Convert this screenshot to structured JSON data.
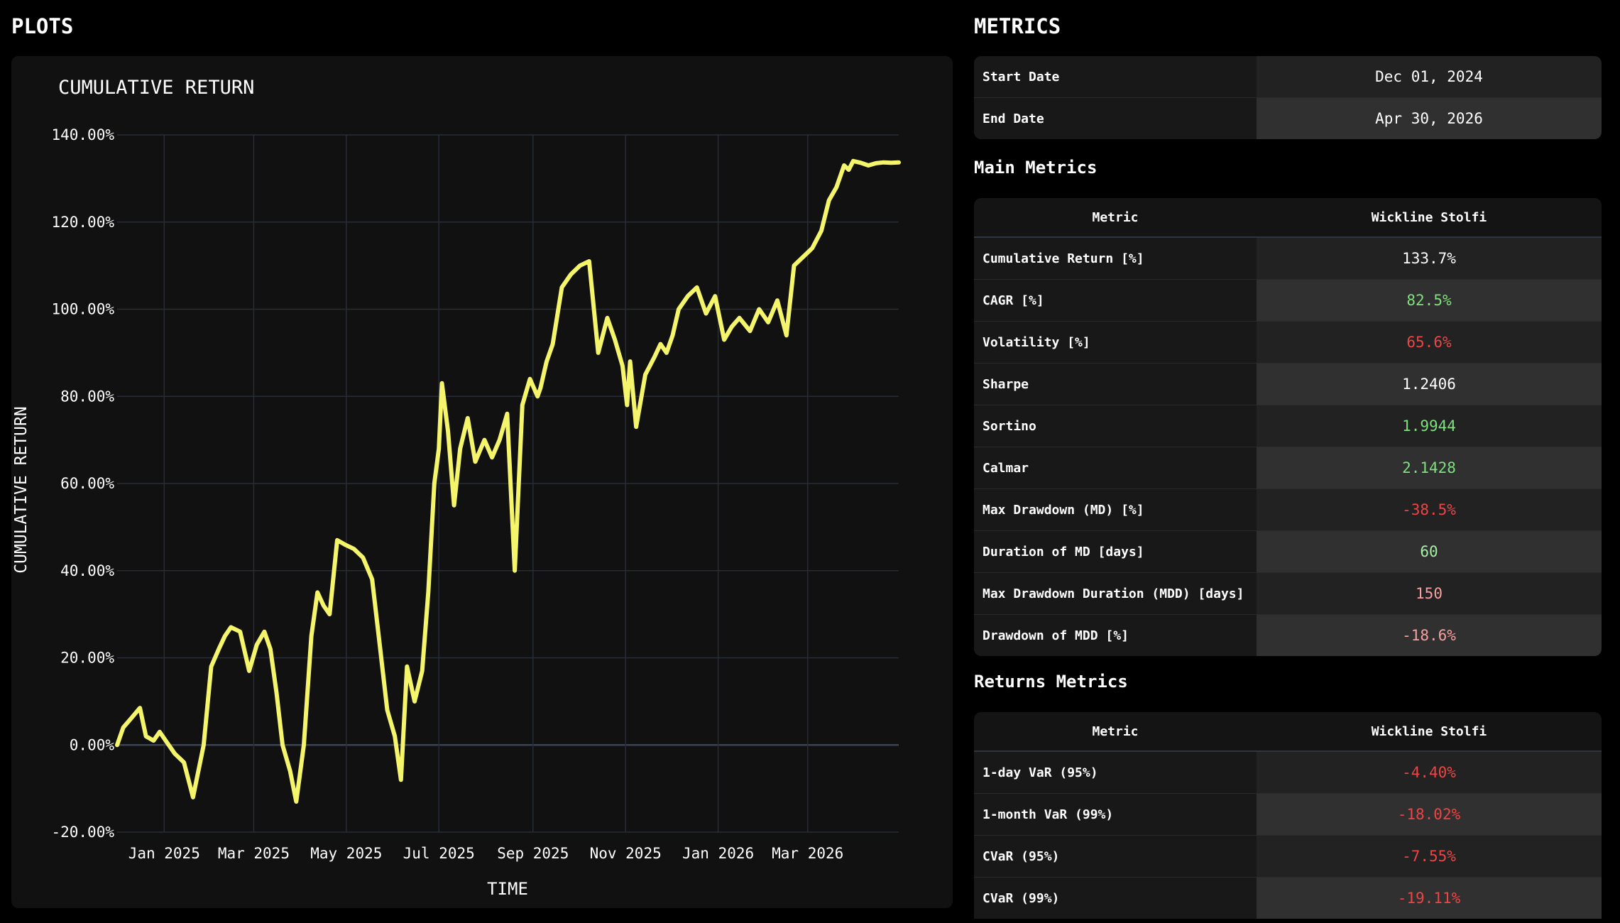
{
  "plots_heading": "PLOTS",
  "metrics_heading": "METRICS",
  "chart_data": {
    "type": "line",
    "title": "CUMULATIVE RETURN",
    "xlabel": "TIME",
    "ylabel": "CUMULATIVE RETURN",
    "ylim": [
      -0.2,
      1.4
    ],
    "yticks": [
      -0.2,
      0,
      0.2,
      0.4,
      0.6,
      0.8,
      1.0,
      1.2,
      1.4
    ],
    "ytick_labels": [
      "-20.00%",
      "0.00%",
      "20.00%",
      "40.00%",
      "60.00%",
      "80.00%",
      "100.00%",
      "120.00%",
      "140.00%"
    ],
    "xlim": [
      "2024-12-01",
      "2026-04-30"
    ],
    "xticks": [
      "2025-01-01",
      "2025-03-01",
      "2025-05-01",
      "2025-07-01",
      "2025-09-01",
      "2025-11-01",
      "2026-01-01",
      "2026-03-01"
    ],
    "xtick_labels": [
      "Jan 2025",
      "Mar 2025",
      "May 2025",
      "Jul 2025",
      "Sep 2025",
      "Nov 2025",
      "Jan 2026",
      "Mar 2026"
    ],
    "grid": true,
    "line_color": "#f5f56b",
    "series": [
      {
        "x": [
          "2024-12-01",
          "2024-12-05",
          "2024-12-10",
          "2024-12-16",
          "2024-12-20",
          "2024-12-25",
          "2024-12-29",
          "2025-01-04",
          "2025-01-08",
          "2025-01-14",
          "2025-01-20",
          "2025-01-27",
          "2025-02-01",
          "2025-02-06",
          "2025-02-10",
          "2025-02-14",
          "2025-02-20",
          "2025-02-26",
          "2025-03-03",
          "2025-03-08",
          "2025-03-12",
          "2025-03-16",
          "2025-03-20",
          "2025-03-25",
          "2025-03-29",
          "2025-04-03",
          "2025-04-08",
          "2025-04-12",
          "2025-04-16",
          "2025-04-20",
          "2025-04-25",
          "2025-04-30",
          "2025-05-06",
          "2025-05-12",
          "2025-05-18",
          "2025-05-23",
          "2025-05-28",
          "2025-06-02",
          "2025-06-06",
          "2025-06-10",
          "2025-06-15",
          "2025-06-20",
          "2025-06-24",
          "2025-06-28",
          "2025-07-01",
          "2025-07-03",
          "2025-07-07",
          "2025-07-11",
          "2025-07-15",
          "2025-07-20",
          "2025-07-25",
          "2025-07-31",
          "2025-08-05",
          "2025-08-10",
          "2025-08-15",
          "2025-08-20",
          "2025-08-25",
          "2025-08-30",
          "2025-09-04",
          "2025-09-06",
          "2025-09-08",
          "2025-09-10",
          "2025-09-14",
          "2025-09-20",
          "2025-09-26",
          "2025-10-02",
          "2025-10-08",
          "2025-10-14",
          "2025-10-20",
          "2025-10-25",
          "2025-10-30",
          "2025-11-02",
          "2025-11-04",
          "2025-11-08",
          "2025-11-14",
          "2025-11-20",
          "2025-11-24",
          "2025-11-28",
          "2025-12-02",
          "2025-12-06",
          "2025-12-12",
          "2025-12-18",
          "2025-12-24",
          "2025-12-30",
          "2026-01-05",
          "2026-01-10",
          "2026-01-15",
          "2026-01-22",
          "2026-01-28",
          "2026-02-03",
          "2026-02-09",
          "2026-02-15",
          "2026-02-20",
          "2026-02-26",
          "2026-03-04",
          "2026-03-10",
          "2026-03-15",
          "2026-03-20",
          "2026-03-25",
          "2026-03-28",
          "2026-03-31",
          "2026-04-05",
          "2026-04-10",
          "2026-04-15",
          "2026-04-20",
          "2026-04-25",
          "2026-04-30"
        ],
        "y": [
          0.0,
          0.04,
          0.06,
          0.085,
          0.02,
          0.01,
          0.03,
          0.0,
          -0.02,
          -0.04,
          -0.12,
          0.0,
          0.18,
          0.22,
          0.25,
          0.27,
          0.26,
          0.17,
          0.23,
          0.26,
          0.22,
          0.12,
          0.0,
          -0.06,
          -0.13,
          0.0,
          0.25,
          0.35,
          0.32,
          0.3,
          0.47,
          0.46,
          0.45,
          0.43,
          0.38,
          0.23,
          0.08,
          0.02,
          -0.08,
          0.18,
          0.1,
          0.17,
          0.35,
          0.6,
          0.68,
          0.83,
          0.72,
          0.55,
          0.68,
          0.75,
          0.65,
          0.7,
          0.66,
          0.7,
          0.76,
          0.4,
          0.78,
          0.84,
          0.8,
          0.82,
          0.85,
          0.88,
          0.92,
          1.05,
          1.08,
          1.1,
          1.11,
          0.9,
          0.98,
          0.93,
          0.87,
          0.78,
          0.88,
          0.73,
          0.85,
          0.89,
          0.92,
          0.9,
          0.94,
          1.0,
          1.03,
          1.05,
          0.99,
          1.03,
          0.93,
          0.96,
          0.98,
          0.95,
          1.0,
          0.97,
          1.02,
          0.94,
          1.1,
          1.12,
          1.14,
          1.18,
          1.25,
          1.28,
          1.33,
          1.32,
          1.34,
          1.336,
          1.33,
          1.335,
          1.337,
          1.336,
          1.337
        ]
      }
    ]
  },
  "dates": {
    "rows": [
      {
        "label": "Start Date",
        "value": "Dec 01, 2024"
      },
      {
        "label": "End Date",
        "value": "Apr 30, 2026"
      }
    ]
  },
  "main_metrics": {
    "title": "Main Metrics",
    "col_metric": "Metric",
    "col_value": "Wickline Stolfi",
    "rows": [
      {
        "label": "Cumulative Return [%]",
        "value": "133.7%",
        "color": "#ffffff"
      },
      {
        "label": "CAGR [%]",
        "value": "82.5%",
        "color": "#7ee07e"
      },
      {
        "label": "Volatility [%]",
        "value": "65.6%",
        "color": "#ef4444"
      },
      {
        "label": "Sharpe",
        "value": "1.2406",
        "color": "#ffffff"
      },
      {
        "label": "Sortino",
        "value": "1.9944",
        "color": "#7ee07e"
      },
      {
        "label": "Calmar",
        "value": "2.1428",
        "color": "#7ee07e"
      },
      {
        "label": "Max Drawdown (MD) [%]",
        "value": "-38.5%",
        "color": "#ef4444"
      },
      {
        "label": "Duration of MD [days]",
        "value": "60",
        "color": "#a6f0a6"
      },
      {
        "label": "Max Drawdown Duration (MDD) [days]",
        "value": "150",
        "color": "#f6a0a0"
      },
      {
        "label": "Drawdown of MDD [%]",
        "value": "-18.6%",
        "color": "#f6a0a0"
      }
    ]
  },
  "returns_metrics": {
    "title": "Returns Metrics",
    "col_metric": "Metric",
    "col_value": "Wickline Stolfi",
    "rows": [
      {
        "label": "1-day VaR (95%)",
        "value": "-4.40%",
        "color": "#ef4444"
      },
      {
        "label": "1-month VaR (99%)",
        "value": "-18.02%",
        "color": "#ef4444"
      },
      {
        "label": "CVaR (95%)",
        "value": "-7.55%",
        "color": "#ef4444"
      },
      {
        "label": "CVaR (99%)",
        "value": "-19.11%",
        "color": "#ef4444"
      }
    ]
  }
}
